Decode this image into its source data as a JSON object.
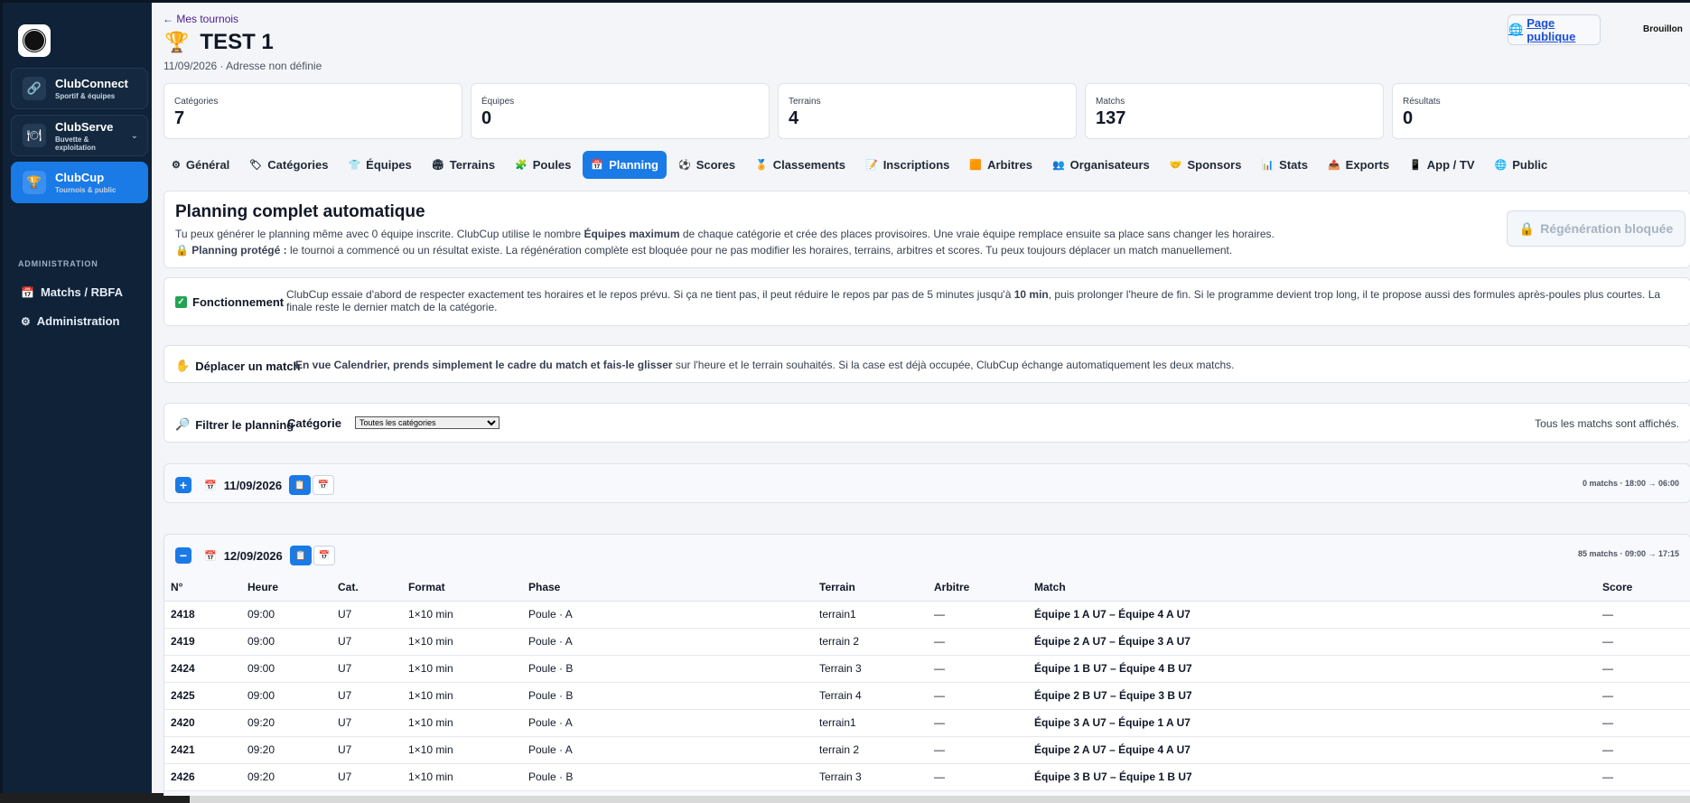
{
  "sidebar": {
    "apps": [
      {
        "title": "ClubConnect",
        "sub": "Sportif & équipes",
        "icon": "link-icon"
      },
      {
        "title": "ClubServe",
        "sub": "Buvette & exploitation",
        "icon": "plate-icon"
      },
      {
        "title": "ClubCup",
        "sub": "Tournois & public",
        "icon": "trophy-icon"
      }
    ],
    "admin_heading": "ADMINISTRATION",
    "links": [
      {
        "label": "Matchs / RBFA",
        "icon": "calendar-icon"
      },
      {
        "label": "Administration",
        "icon": "gear-icon"
      }
    ]
  },
  "header": {
    "back": "← Mes tournois",
    "title": "TEST 1",
    "subtitle": "11/09/2026 · Adresse non définie",
    "public_btn": "Page publique",
    "status": "Brouillon"
  },
  "stats": [
    {
      "label": "Catégories",
      "value": "7"
    },
    {
      "label": "Équipes",
      "value": "0"
    },
    {
      "label": "Terrains",
      "value": "4"
    },
    {
      "label": "Matchs",
      "value": "137"
    },
    {
      "label": "Résultats",
      "value": "0"
    }
  ],
  "tabs": [
    {
      "label": "Général",
      "icon": "⚙",
      "name": "tab-general"
    },
    {
      "label": "Catégories",
      "icon": "🏷",
      "name": "tab-categories"
    },
    {
      "label": "Équipes",
      "icon": "👕",
      "name": "tab-equipes"
    },
    {
      "label": "Terrains",
      "icon": "🏟",
      "name": "tab-terrains"
    },
    {
      "label": "Poules",
      "icon": "🧩",
      "name": "tab-poules"
    },
    {
      "label": "Planning",
      "icon": "📅",
      "name": "tab-planning",
      "active": true
    },
    {
      "label": "Scores",
      "icon": "⚽",
      "name": "tab-scores"
    },
    {
      "label": "Classements",
      "icon": "🏅",
      "name": "tab-classements"
    },
    {
      "label": "Inscriptions",
      "icon": "📝",
      "name": "tab-inscriptions"
    },
    {
      "label": "Arbitres",
      "icon": "🟧",
      "name": "tab-arbitres"
    },
    {
      "label": "Organisateurs",
      "icon": "👥",
      "name": "tab-organisateurs"
    },
    {
      "label": "Sponsors",
      "icon": "🤝",
      "name": "tab-sponsors"
    },
    {
      "label": "Stats",
      "icon": "📊",
      "name": "tab-stats"
    },
    {
      "label": "Exports",
      "icon": "📤",
      "name": "tab-exports"
    },
    {
      "label": "App / TV",
      "icon": "📱",
      "name": "tab-app-tv"
    },
    {
      "label": "Public",
      "icon": "🌐",
      "name": "tab-public"
    }
  ],
  "planning": {
    "title": "Planning complet automatique",
    "line1_a": "Tu peux générer le planning même avec 0 équipe inscrite. ClubCup utilise le nombre ",
    "line1_b": "Équipes maximum",
    "line1_c": " de chaque catégorie et crée des places provisoires. Une vraie équipe remplace ensuite sa place sans changer les horaires.",
    "line2_a": "Planning protégé :",
    "line2_b": " le tournoi a commencé ou un résultat existe. La régénération complète est bloquée pour ne pas modifier les horaires, terrains, arbitres et scores. Tu peux toujours déplacer un match manuellement.",
    "regen_btn": "Régénération bloquée"
  },
  "fonctionnement": {
    "label": "Fonctionnement",
    "text_a": "ClubCup essaie d'abord de respecter exactement tes horaires et le repos prévu. Si ça ne tient pas, il peut réduire le repos par pas de 5 minutes jusqu'à ",
    "text_b": "10 min",
    "text_c": ", puis prolonger l'heure de fin. Si le programme devient trop long, il te propose aussi des formules après-poules plus courtes. La finale reste le dernier match de la catégorie."
  },
  "deplacer": {
    "label": "Déplacer un match",
    "text_a": "En vue Calendrier, prends simplement le cadre du match et fais-le glisser",
    "text_b": " sur l'heure et le terrain souhaités. Si la case est déjà occupée, ClubCup échange automatiquement les deux matchs."
  },
  "filter": {
    "label": "Filtrer le planning",
    "cat_label": "Catégorie",
    "selected": "Toutes les catégories",
    "info": "Tous les matchs sont affichés."
  },
  "days": [
    {
      "toggle": "+",
      "date": "11/09/2026",
      "meta": "0 matchs · 18:00 → 06:00"
    },
    {
      "toggle": "−",
      "date": "12/09/2026",
      "meta": "85 matchs · 09:00 → 17:15"
    }
  ],
  "table": {
    "headers": [
      "N°",
      "Heure",
      "Cat.",
      "Format",
      "Phase",
      "Terrain",
      "Arbitre",
      "Match",
      "Score"
    ],
    "rows": [
      [
        "2418",
        "09:00",
        "U7",
        "1×10 min",
        "Poule · A",
        "terrain1",
        "—",
        "Équipe 1 A U7 – Équipe 4 A U7",
        "—"
      ],
      [
        "2419",
        "09:00",
        "U7",
        "1×10 min",
        "Poule · A",
        "terrain 2",
        "—",
        "Équipe 2 A U7 – Équipe 3 A U7",
        "—"
      ],
      [
        "2424",
        "09:00",
        "U7",
        "1×10 min",
        "Poule · B",
        "Terrain 3",
        "—",
        "Équipe 1 B U7 – Équipe 4 B U7",
        "—"
      ],
      [
        "2425",
        "09:00",
        "U7",
        "1×10 min",
        "Poule · B",
        "Terrain 4",
        "—",
        "Équipe 2 B U7 – Équipe 3 B U7",
        "—"
      ],
      [
        "2420",
        "09:20",
        "U7",
        "1×10 min",
        "Poule · A",
        "terrain1",
        "—",
        "Équipe 3 A U7 – Équipe 1 A U7",
        "—"
      ],
      [
        "2421",
        "09:20",
        "U7",
        "1×10 min",
        "Poule · A",
        "terrain 2",
        "—",
        "Équipe 2 A U7 – Équipe 4 A U7",
        "—"
      ],
      [
        "2426",
        "09:20",
        "U7",
        "1×10 min",
        "Poule · B",
        "Terrain 3",
        "—",
        "Équipe 3 B U7 – Équipe 1 B U7",
        "—"
      ]
    ]
  },
  "colors": {
    "accent": "#1a7ae6",
    "sidebar": "#0f2238"
  }
}
